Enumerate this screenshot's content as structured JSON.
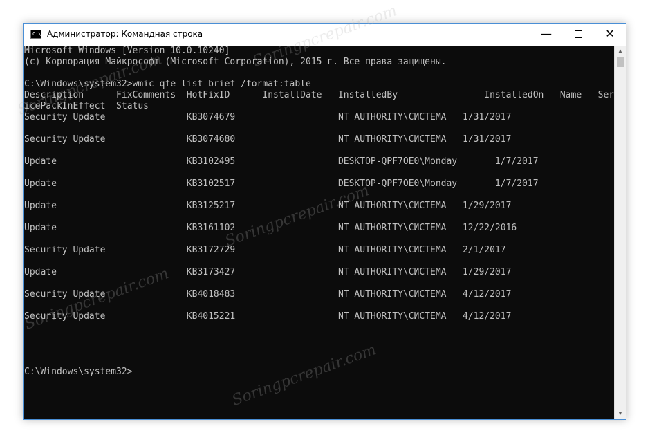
{
  "window": {
    "title": "Администратор: Командная строка",
    "icon_name": "cmd-icon",
    "controls": {
      "minimize": "—",
      "close": "✕"
    }
  },
  "console": {
    "lines": [
      "Microsoft Windows [Version 10.0.10240]",
      "(c) Корпорация Майкрософт (Microsoft Corporation), 2015 г. Все права защищены.",
      "",
      "C:\\Windows\\system32>wmic qfe list brief /format:table",
      "Description      FixComments  HotFixID      InstallDate   InstalledBy                InstalledOn   Name   Serv",
      "icePackInEffect  Status",
      "Security Update               KB3074679                   NT AUTHORITY\\СИСТЕМА   1/31/2017",
      "",
      "Security Update               KB3074680                   NT AUTHORITY\\СИСТЕМА   1/31/2017",
      "",
      "Update                        KB3102495                   DESKTOP-QPF7OE0\\Monday       1/7/2017",
      "",
      "Update                        KB3102517                   DESKTOP-QPF7OE0\\Monday       1/7/2017",
      "",
      "Update                        KB3125217                   NT AUTHORITY\\СИСТЕМА   1/29/2017",
      "",
      "Update                        KB3161102                   NT AUTHORITY\\СИСТЕМА   12/22/2016",
      "",
      "Security Update               KB3172729                   NT AUTHORITY\\СИСТЕМА   2/1/2017",
      "",
      "Update                        KB3173427                   NT AUTHORITY\\СИСТЕМА   1/29/2017",
      "",
      "Security Update               KB4018483                   NT AUTHORITY\\СИСТЕМА   4/12/2017",
      "",
      "Security Update               KB4015221                   NT AUTHORITY\\СИСТЕМА   4/12/2017",
      "",
      "",
      "",
      "",
      "C:\\Windows\\system32>"
    ]
  },
  "watermark": "Soringpcrepair.com",
  "colors": {
    "console_bg": "#0c0c0c",
    "console_text": "#c0c0c0",
    "border": "#4a8fd6"
  }
}
